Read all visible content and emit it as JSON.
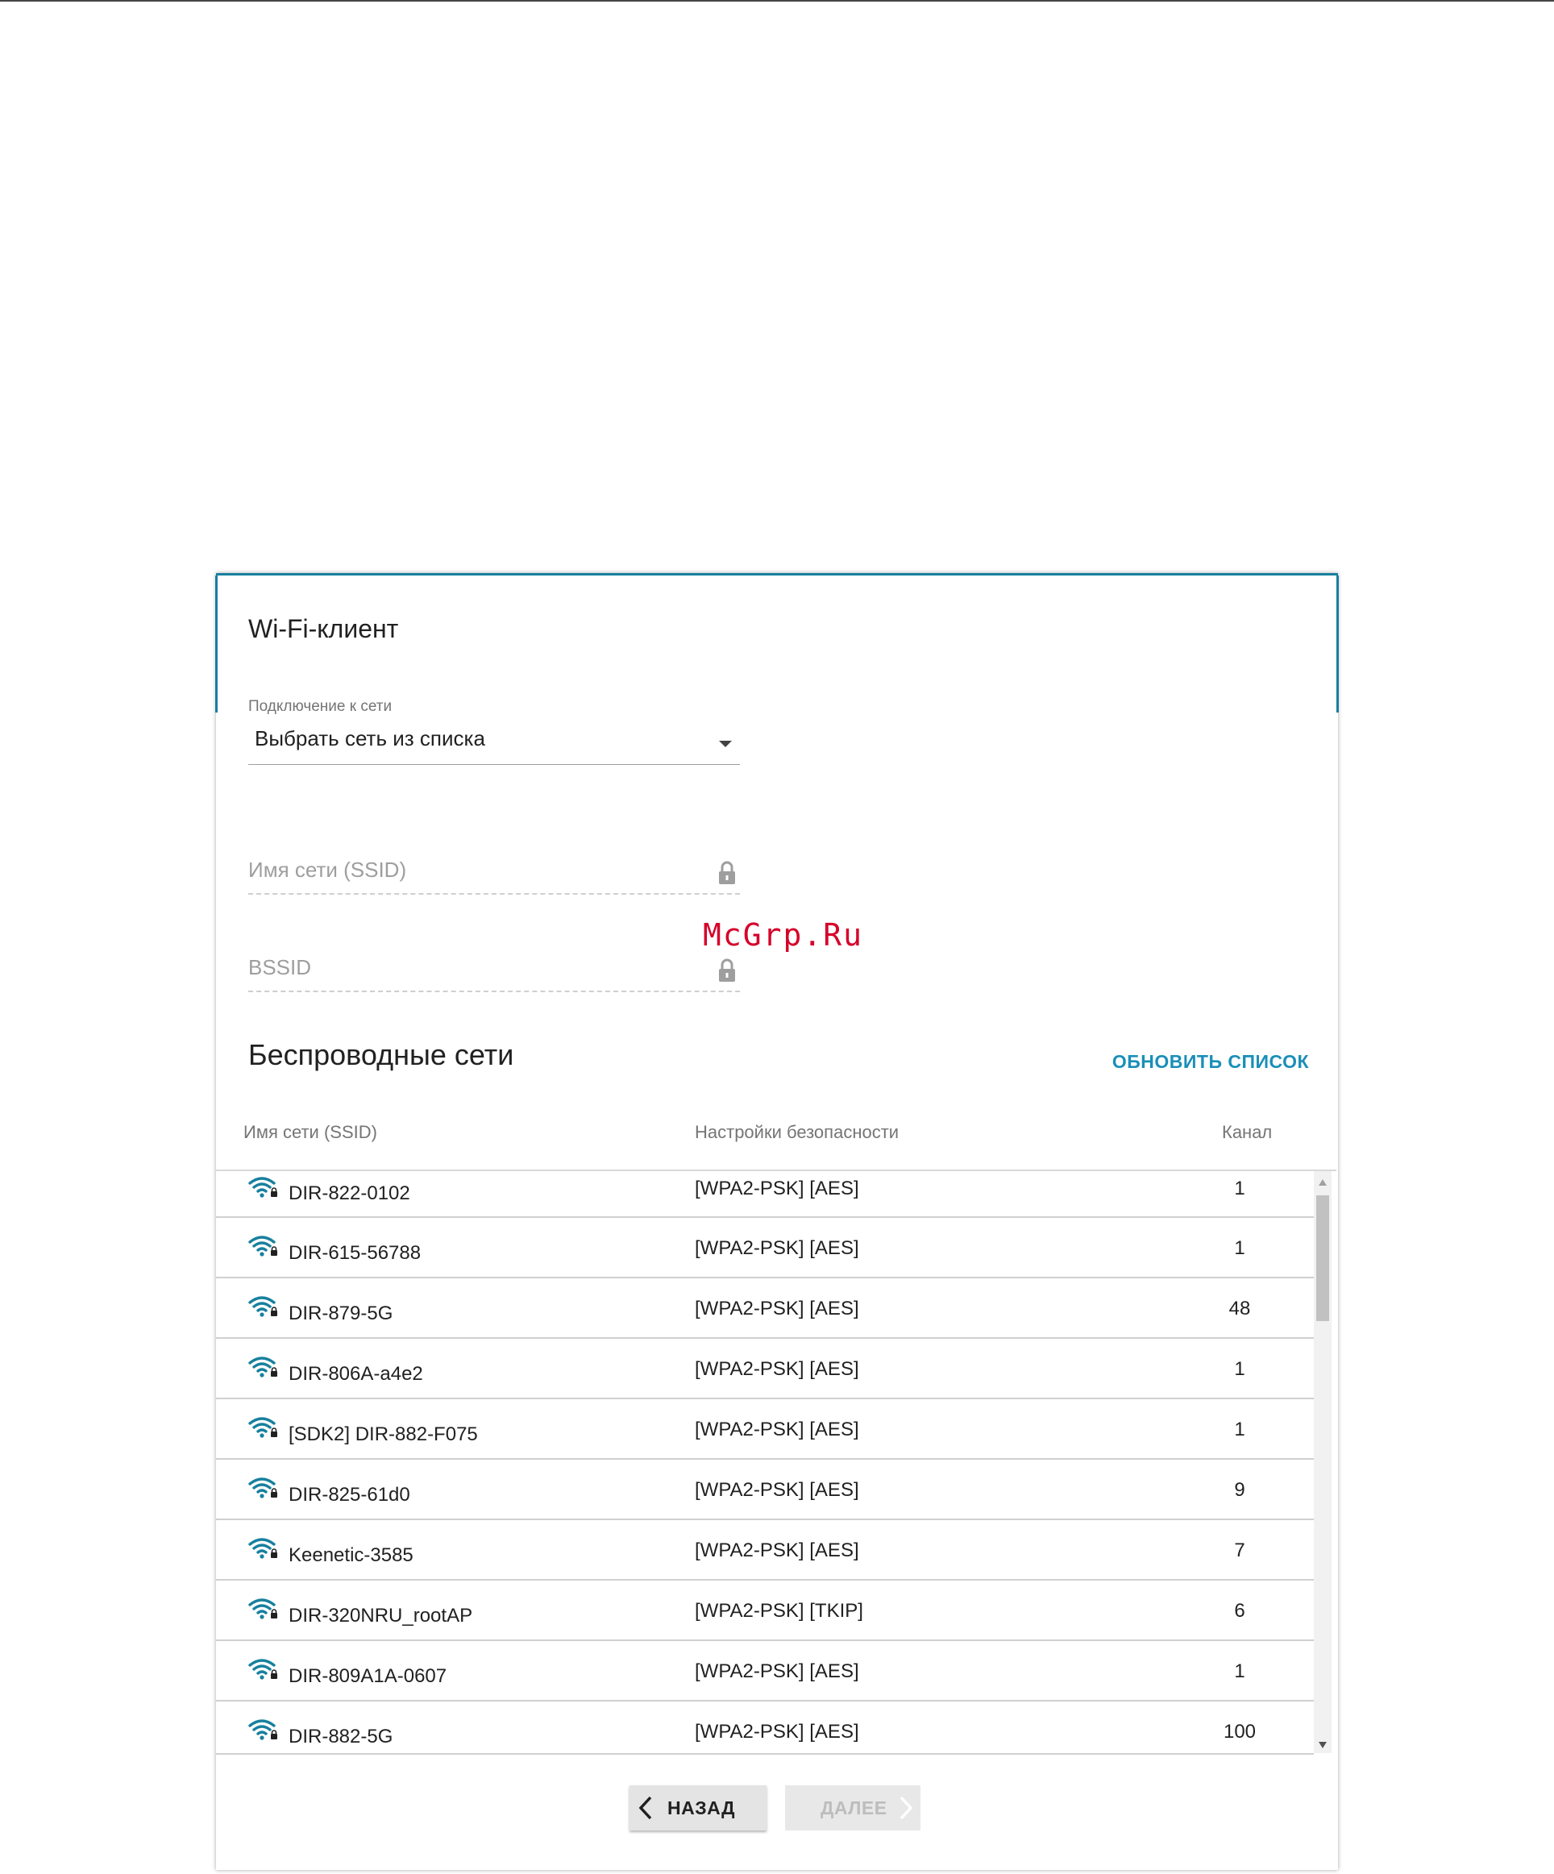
{
  "page": {
    "title": "Wi-Fi-клиент",
    "watermark": "McGrp.Ru"
  },
  "connection": {
    "label": "Подключение к сети",
    "selected": "Выбрать сеть из списка"
  },
  "ssid_input": {
    "placeholder": "Имя сети (SSID)"
  },
  "bssid_input": {
    "placeholder": "BSSID"
  },
  "networks": {
    "title": "Беспроводные сети",
    "refresh_label": "ОБНОВИТЬ СПИСОК",
    "columns": {
      "ssid": "Имя сети (SSID)",
      "security": "Настройки безопасности",
      "channel": "Канал"
    },
    "rows": [
      {
        "ssid": "DIR-822-0102",
        "security": "[WPA2-PSK] [AES]",
        "channel": "1"
      },
      {
        "ssid": "DIR-615-56788",
        "security": "[WPA2-PSK] [AES]",
        "channel": "1"
      },
      {
        "ssid": "DIR-879-5G",
        "security": "[WPA2-PSK] [AES]",
        "channel": "48"
      },
      {
        "ssid": "DIR-806A-a4e2",
        "security": "[WPA2-PSK] [AES]",
        "channel": "1"
      },
      {
        "ssid": "[SDK2] DIR-882-F075",
        "security": "[WPA2-PSK] [AES]",
        "channel": "1"
      },
      {
        "ssid": "DIR-825-61d0",
        "security": "[WPA2-PSK] [AES]",
        "channel": "9"
      },
      {
        "ssid": "Keenetic-3585",
        "security": "[WPA2-PSK] [AES]",
        "channel": "7"
      },
      {
        "ssid": "DIR-320NRU_rootAP",
        "security": "[WPA2-PSK] [TKIP]",
        "channel": "6"
      },
      {
        "ssid": "DIR-809A1A-0607",
        "security": "[WPA2-PSK] [AES]",
        "channel": "1"
      },
      {
        "ssid": "DIR-882-5G",
        "security": "[WPA2-PSK] [AES]",
        "channel": "100"
      }
    ]
  },
  "footer": {
    "back_label": "НАЗАД",
    "next_label": "ДАЛЕЕ"
  },
  "colors": {
    "accent": "#17809e",
    "link": "#1a8fb8",
    "wifi_icon": "#17809e",
    "watermark": "#d6002a"
  },
  "icons": {
    "network_row": "wifi-locked-icon",
    "locked_field": "lock-icon",
    "select_caret": "caret-down-icon",
    "back": "chevron-left-icon",
    "next": "chevron-right-icon"
  }
}
